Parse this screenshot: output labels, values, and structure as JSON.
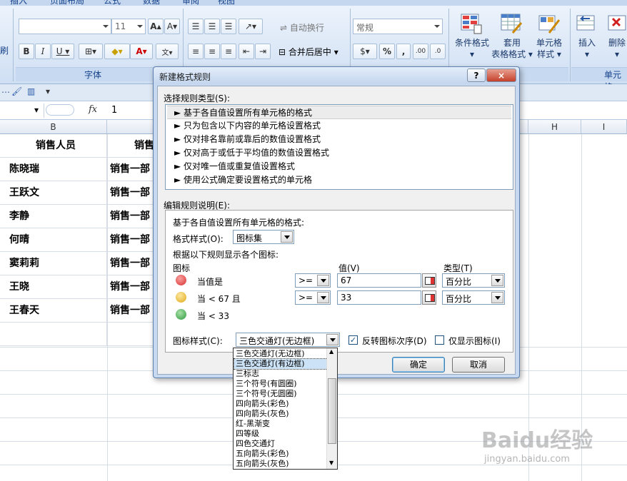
{
  "ribbon": {
    "tabs": [
      "插入",
      "页面布局",
      "公式",
      "数据",
      "审阅",
      "视图"
    ],
    "font_size": "11",
    "number_format": "常规",
    "wrap_text": "自动换行",
    "merge_center": "合并后居中",
    "font_group_label": "字体",
    "cell_group_label": "单元格",
    "side_label": "刷",
    "conditional_format": "条件格式",
    "table_format_1": "套用",
    "table_format_2": "表格格式",
    "cell_style_1": "单元格",
    "cell_style_2": "样式",
    "insert": "插入",
    "delete": "删除"
  },
  "formula": {
    "value": "1",
    "fx": "fx"
  },
  "columns": {
    "B": "B",
    "H": "H",
    "I": "I"
  },
  "sheet": {
    "header_b": "销售人员",
    "header_c": "销售",
    "rows": [
      {
        "name": "陈晓瑞",
        "dept": "销售一部"
      },
      {
        "name": "王跃文",
        "dept": "销售一部"
      },
      {
        "name": "李静",
        "dept": "销售一部"
      },
      {
        "name": "何晴",
        "dept": "销售一部"
      },
      {
        "name": "窦莉莉",
        "dept": "销售一部"
      },
      {
        "name": "王晓",
        "dept": "销售一部"
      },
      {
        "name": "王春天",
        "dept": "销售一部"
      }
    ]
  },
  "dialog": {
    "title": "新建格式规则",
    "help": "?",
    "close": "×",
    "select_rule_type": "选择规则类型(S):",
    "rule_types": [
      "► 基于各自值设置所有单元格的格式",
      "► 只为包含以下内容的单元格设置格式",
      "► 仅对排名靠前或靠后的数值设置格式",
      "► 仅对高于或低于平均值的数值设置格式",
      "► 仅对唯一值或重复值设置格式",
      "► 使用公式确定要设置格式的单元格"
    ],
    "edit_desc": "编辑规则说明(E):",
    "desc_title": "基于各自值设置所有单元格的格式:",
    "format_style_label": "格式样式(O):",
    "format_style_value": "图标集",
    "show_rule_label": "根据以下规则显示各个图标:",
    "col_icon": "图标",
    "col_value": "值(V)",
    "col_type": "类型(T)",
    "rule1_text": "当值是",
    "rule1_op": ">=",
    "rule1_value": "67",
    "rule1_type": "百分比",
    "rule2_text": "当 < 67 且",
    "rule2_op": ">=",
    "rule2_value": "33",
    "rule2_type": "百分比",
    "rule3_text": "当 < 33",
    "icon_style_label": "图标样式(C):",
    "icon_style_value": "三色交通灯(无边框)",
    "reverse_label": "反转图标次序(D)",
    "icon_only_label": "仅显示图标(I)",
    "reverse_checked": "✓",
    "ok": "确定",
    "cancel": "取消",
    "colors": {
      "red": "#e04040",
      "yellow": "#f0c020",
      "green": "#3aa84a"
    }
  },
  "icon_styles": [
    "三色交通灯(无边框)",
    "三色交通灯(有边框)",
    "三标志",
    "三个符号(有圆圈)",
    "三个符号(无圆圈)",
    "四向箭头(彩色)",
    "四向箭头(灰色)",
    "红-黑渐变",
    "四等级",
    "四色交通灯",
    "五向箭头(彩色)",
    "五向箭头(灰色)"
  ],
  "watermark": {
    "brand": "Baidu经验",
    "url": "jingyan.baidu.com"
  }
}
